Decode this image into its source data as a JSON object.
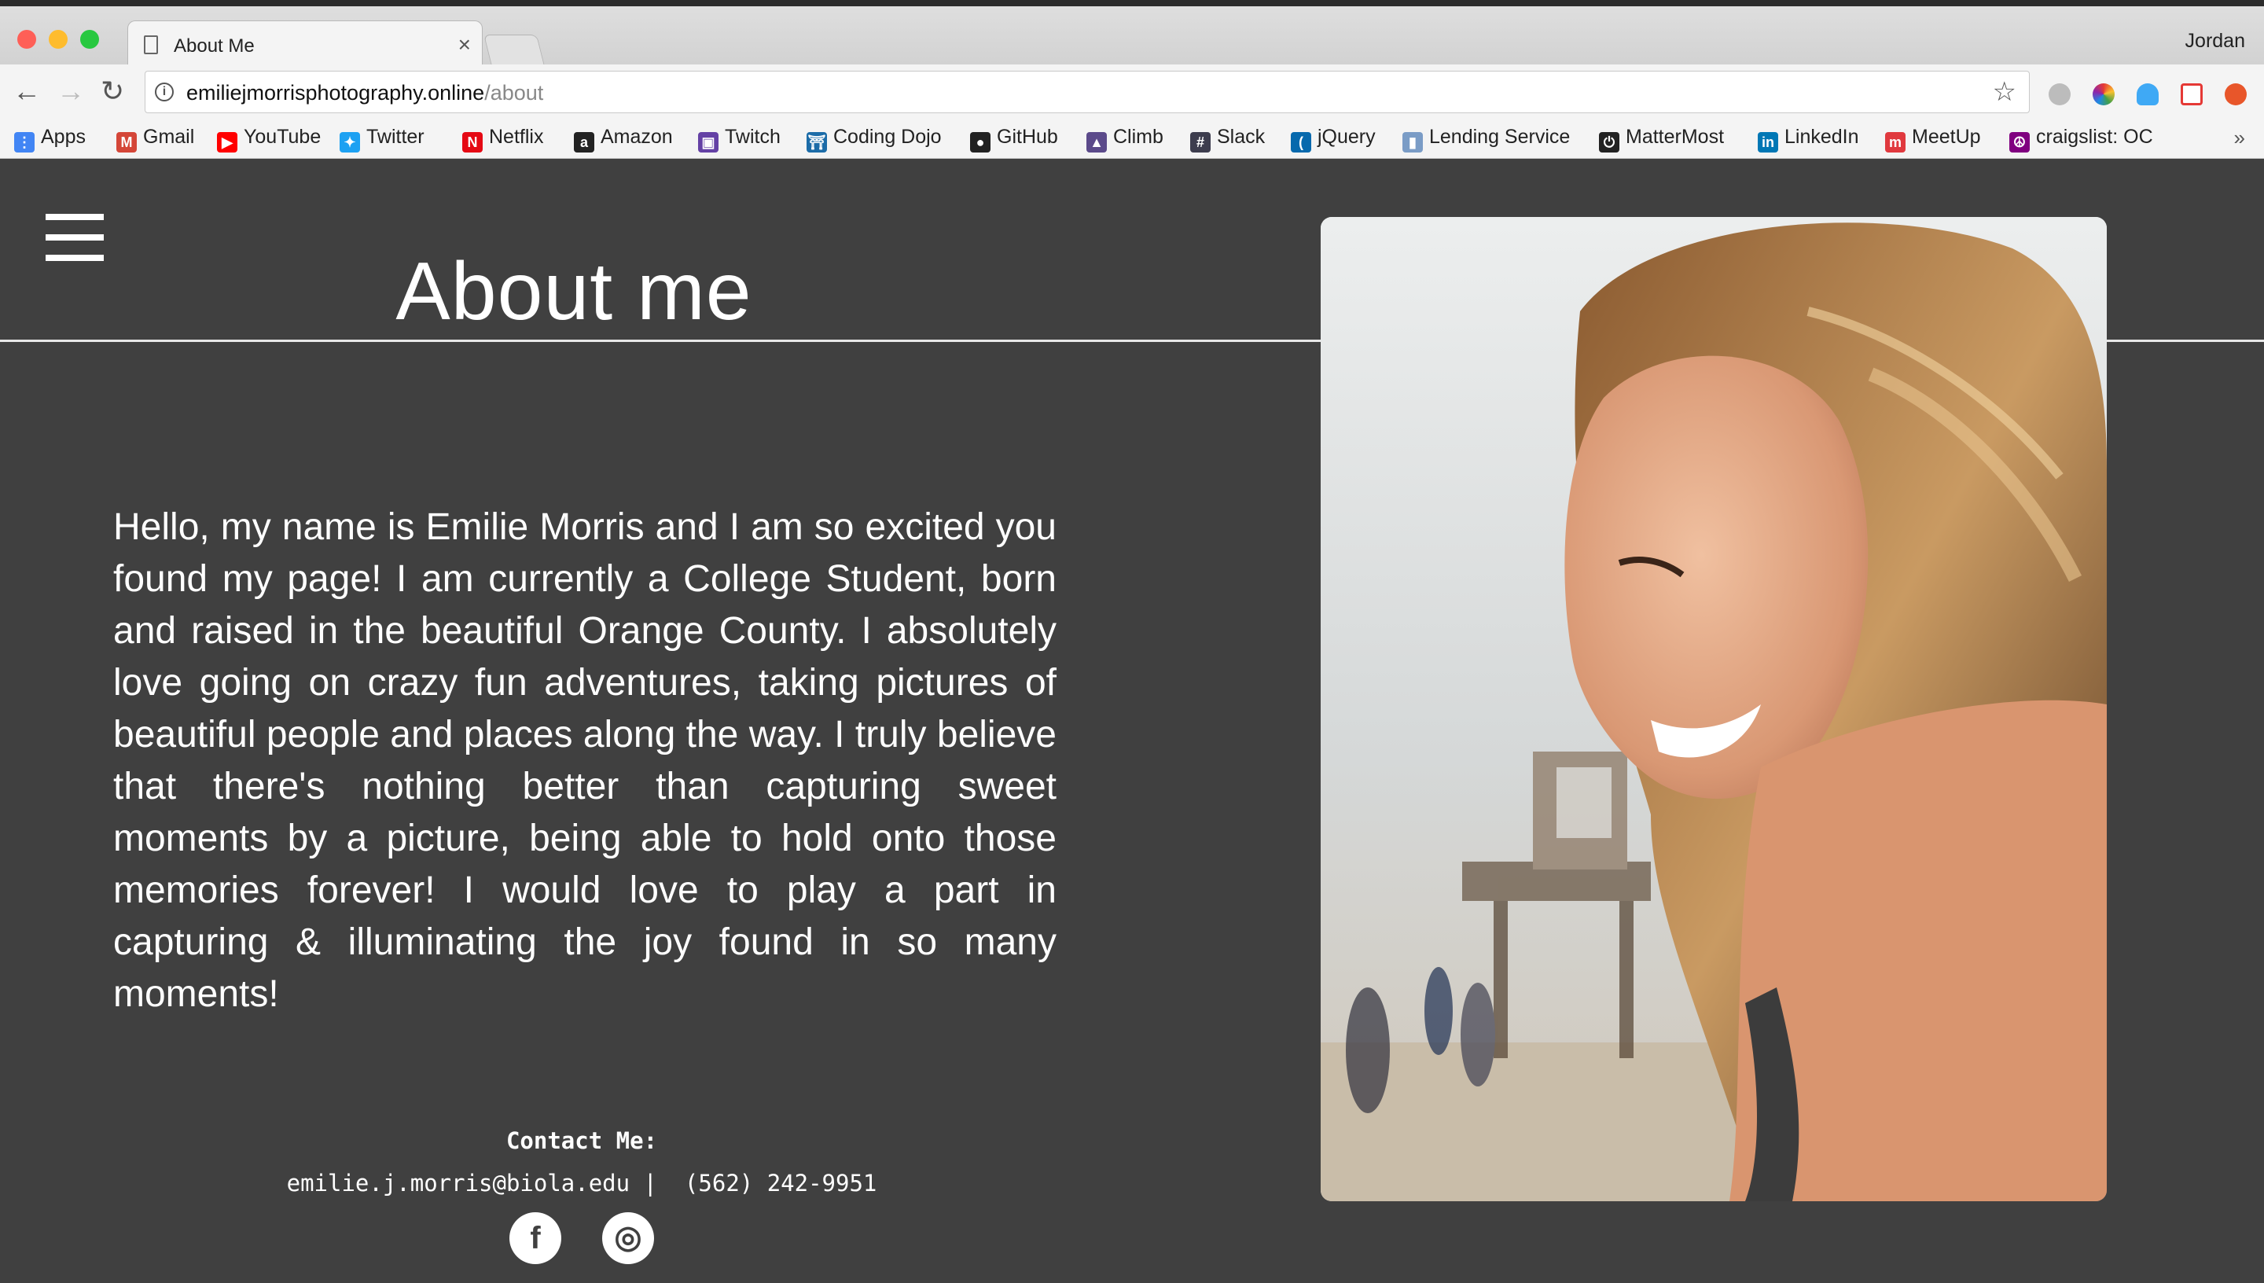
{
  "browser": {
    "tab_title": "About Me",
    "tab_close": "×",
    "profile_name": "Jordan",
    "url_host": "emiliejmorrisphotography.online",
    "url_path": "/about",
    "back": "←",
    "forward": "→",
    "reload": "↻",
    "star": "☆",
    "more": "»",
    "traffic_colors": {
      "close": "#fe5f57",
      "minimize": "#febc2e",
      "zoom": "#28c840"
    },
    "bookmarks": [
      {
        "label": "Apps",
        "icon": "apps-grid-icon",
        "color": "#4285f4"
      },
      {
        "label": "Gmail",
        "icon": "gmail-icon",
        "color": "#d44638"
      },
      {
        "label": "YouTube",
        "icon": "youtube-icon",
        "color": "#ff0000"
      },
      {
        "label": "Twitter",
        "icon": "twitter-icon",
        "color": "#1da1f2"
      },
      {
        "label": "Netflix",
        "icon": "netflix-icon",
        "color": "#e50914"
      },
      {
        "label": "Amazon",
        "icon": "amazon-icon",
        "color": "#222222"
      },
      {
        "label": "Twitch",
        "icon": "twitch-icon",
        "color": "#6441a5"
      },
      {
        "label": "Coding Dojo",
        "icon": "coding-dojo-icon",
        "color": "#1c6ca8"
      },
      {
        "label": "GitHub",
        "icon": "github-icon",
        "color": "#222222"
      },
      {
        "label": "Climb",
        "icon": "climb-icon",
        "color": "#5b4a8a"
      },
      {
        "label": "Slack",
        "icon": "slack-icon",
        "color": "#3d3d4e"
      },
      {
        "label": "jQuery",
        "icon": "jquery-icon",
        "color": "#0769ad"
      },
      {
        "label": "Lending Service",
        "icon": "lending-service-icon",
        "color": "#7a9cc6"
      },
      {
        "label": "MatterMost",
        "icon": "mattermost-icon",
        "color": "#222222"
      },
      {
        "label": "LinkedIn",
        "icon": "linkedin-icon",
        "color": "#0077b5"
      },
      {
        "label": "MeetUp",
        "icon": "meetup-icon",
        "color": "#e0393e"
      },
      {
        "label": "craigslist: OC",
        "icon": "craigslist-icon",
        "color": "#800080"
      }
    ]
  },
  "page": {
    "heading": "About me",
    "bio": "Hello, my name is Emilie Morris and I am so excited you found my page! I am currently a College Student, born and raised in the beautiful Orange County. I absolutely love going on crazy fun adventures, taking pictures of beautiful people and places along the way. I truly believe that there's nothing better than capturing sweet moments by a picture, being able to hold onto those memories forever! I would love to play a part in capturing & illuminating the joy found in so many moments!",
    "contact_title": "Contact Me:",
    "contact_line": "emilie.j.morris@biola.edu |  (562) 242-9951",
    "social": [
      {
        "icon": "facebook-icon",
        "glyph": "f"
      },
      {
        "icon": "instagram-icon",
        "glyph": "◎"
      }
    ],
    "photo_icon": "portrait-photo",
    "background_color": "#404040"
  }
}
